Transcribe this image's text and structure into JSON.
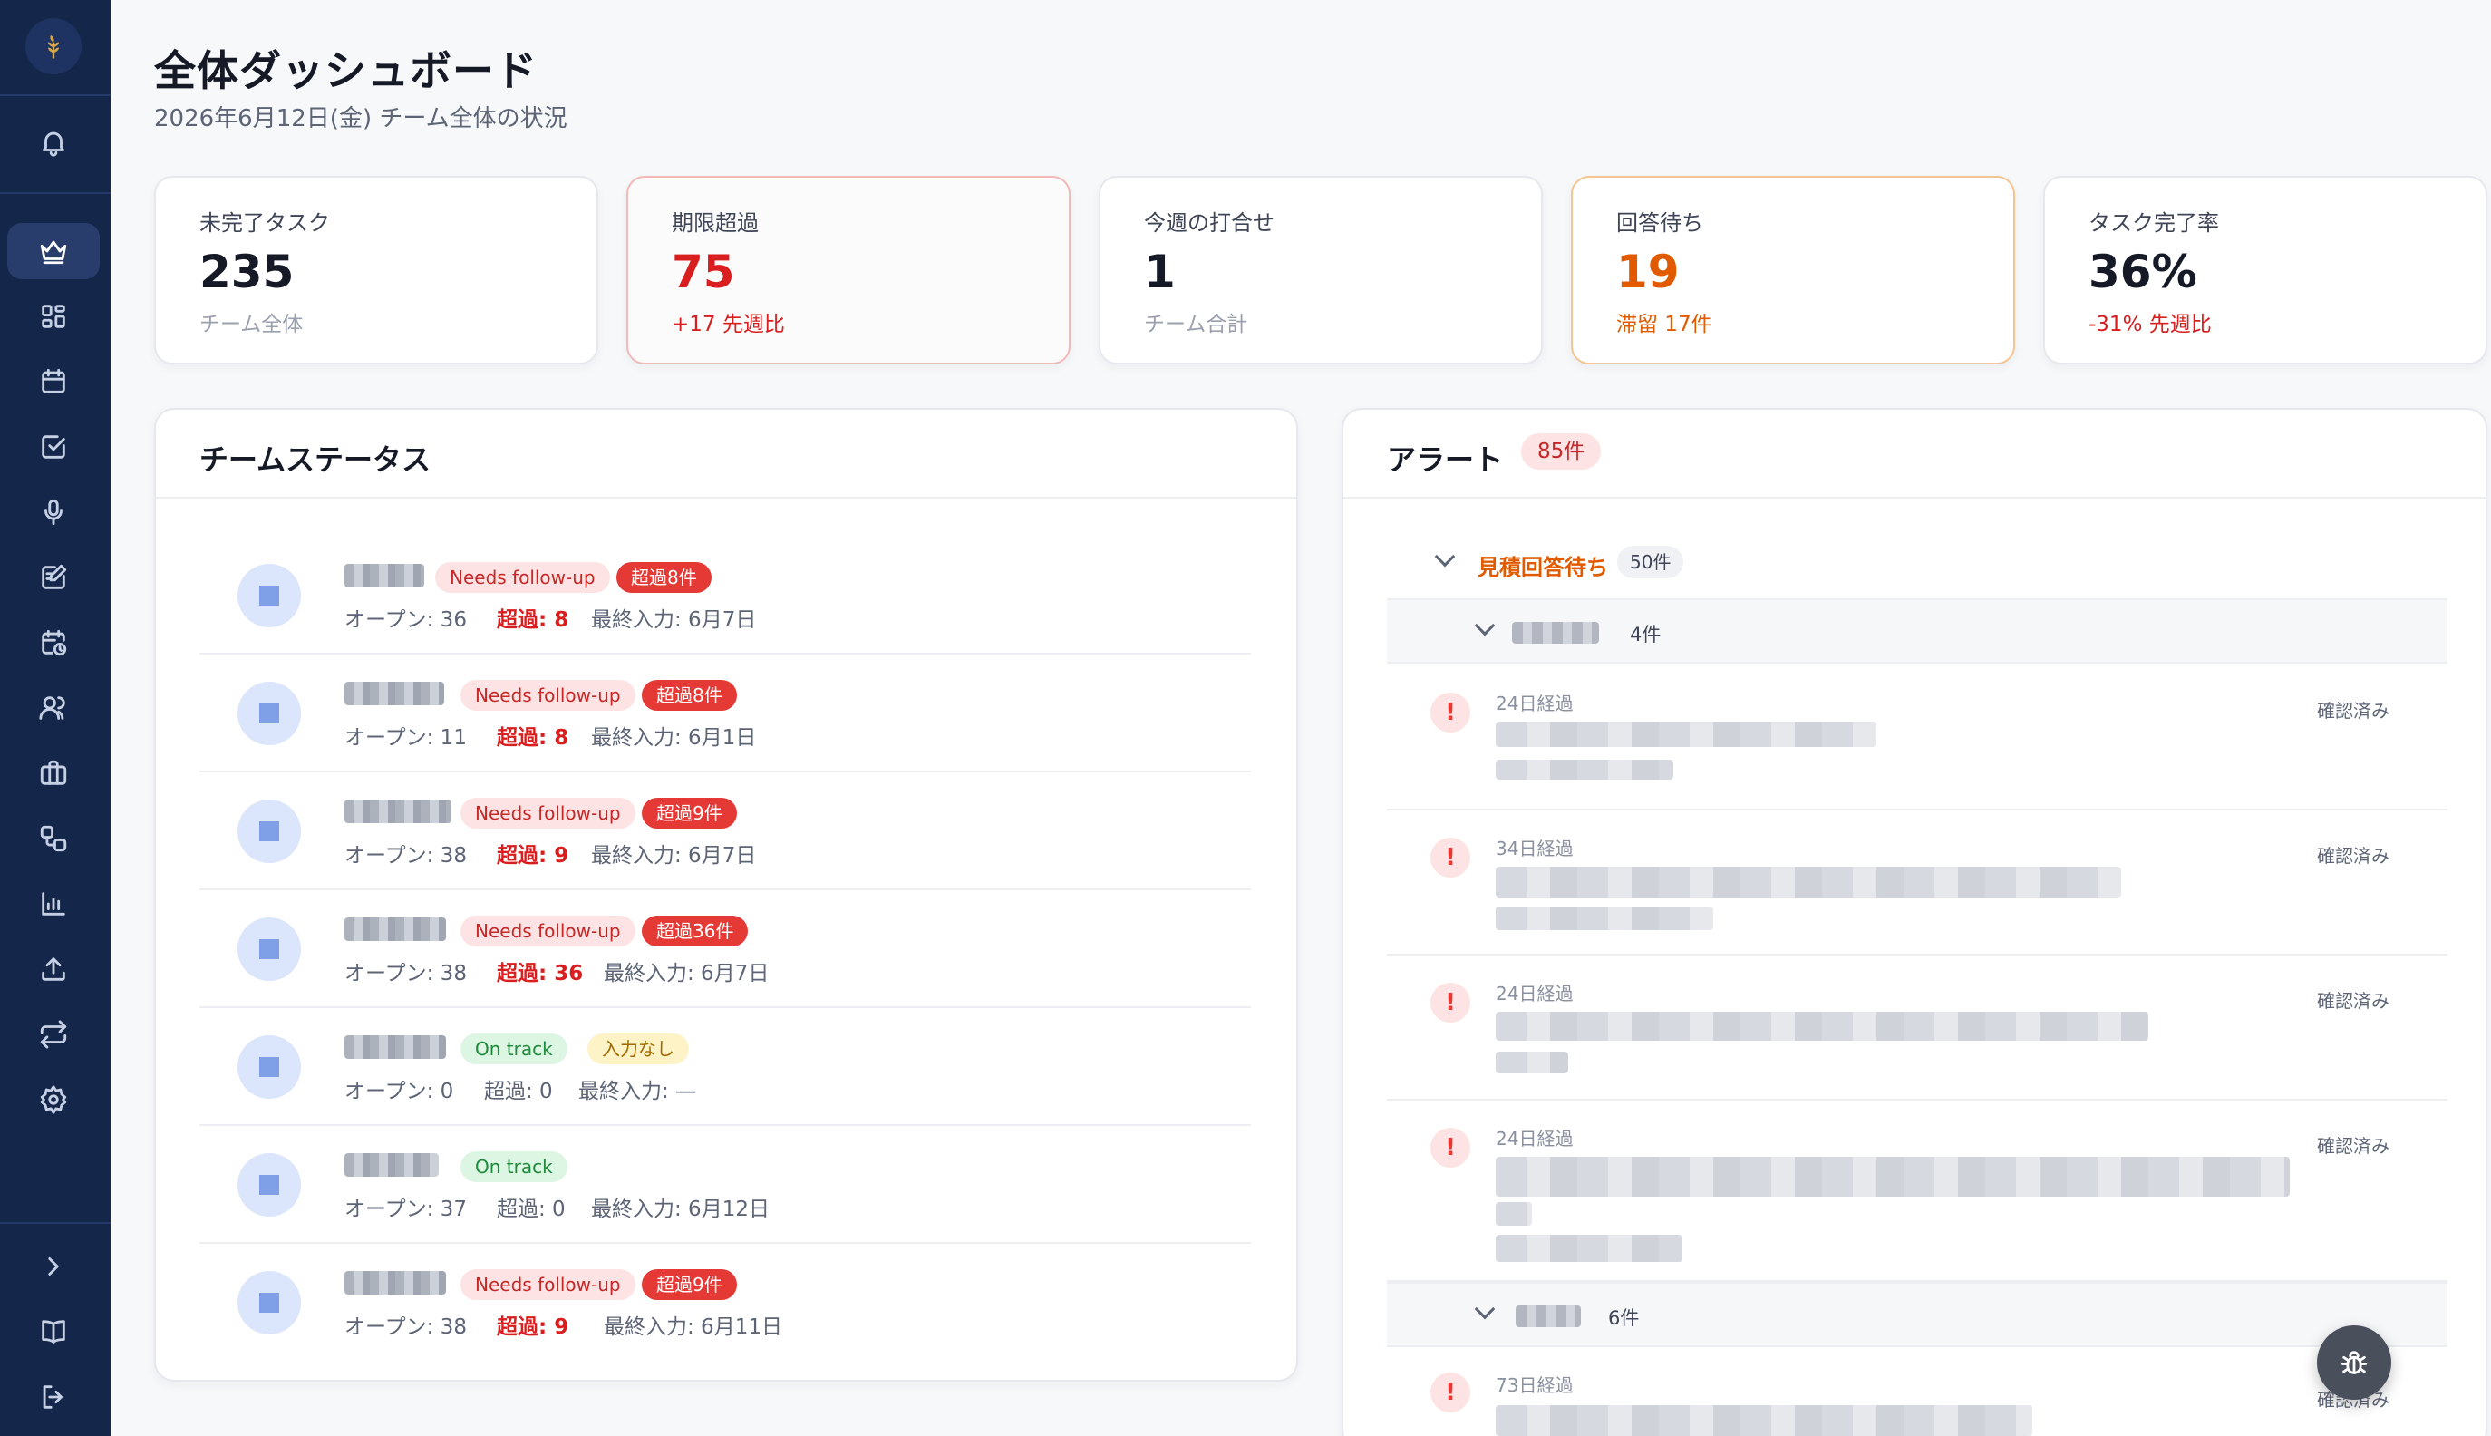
{
  "header": {
    "title": "全体ダッシュボード",
    "subtitle": "2026年6月12日(金) チーム全体の状況"
  },
  "stats": [
    {
      "label": "未完了タスク",
      "value": "235",
      "sub": "チーム全体"
    },
    {
      "label": "期限超過",
      "value": "75",
      "sub": "+17 先週比"
    },
    {
      "label": "今週の打合せ",
      "value": "1",
      "sub": "チーム合計"
    },
    {
      "label": "回答待ち",
      "value": "19",
      "sub": "滞留 17件"
    },
    {
      "label": "タスク完了率",
      "value": "36%",
      "sub": "-31% 先週比"
    }
  ],
  "team_status": {
    "title": "チームステータス",
    "members": [
      {
        "status": "Needs follow-up",
        "overdue_badge": "超過8件",
        "open": "オープン: 36",
        "overdue": "超過: 8",
        "last_input": "最終入力: 6月7日"
      },
      {
        "status": "Needs follow-up",
        "overdue_badge": "超過8件",
        "open": "オープン: 11",
        "overdue": "超過: 8",
        "last_input": "最終入力: 6月1日"
      },
      {
        "status": "Needs follow-up",
        "overdue_badge": "超過9件",
        "open": "オープン: 38",
        "overdue": "超過: 9",
        "last_input": "最終入力: 6月7日"
      },
      {
        "status": "Needs follow-up",
        "overdue_badge": "超過36件",
        "open": "オープン: 38",
        "overdue": "超過: 36",
        "last_input": "最終入力: 6月7日"
      },
      {
        "status": "On track",
        "overdue_badge": "入力なし",
        "open": "オープン: 0",
        "overdue": "超過: 0",
        "last_input": "最終入力: —"
      },
      {
        "status": "On track",
        "overdue_badge": "",
        "open": "オープン: 37",
        "overdue": "超過: 0",
        "last_input": "最終入力: 6月12日"
      },
      {
        "status": "Needs follow-up",
        "overdue_badge": "超過9件",
        "open": "オープン: 38",
        "overdue": "超過: 9",
        "last_input": "最終入力: 6月11日"
      }
    ]
  },
  "alerts": {
    "title": "アラート",
    "count": "85件",
    "group": {
      "title": "見積回答待ち",
      "count": "50件"
    },
    "subgroups": [
      {
        "count": "4件"
      },
      {
        "count": "6件"
      }
    ],
    "items": [
      {
        "elapsed": "24日経過",
        "action": "確認済み"
      },
      {
        "elapsed": "34日経過",
        "action": "確認済み"
      },
      {
        "elapsed": "24日経過",
        "action": "確認済み"
      },
      {
        "elapsed": "24日経過",
        "action": "確認済み"
      },
      {
        "elapsed": "73日経過",
        "action": "確認済み"
      }
    ],
    "warn_glyph": "!"
  },
  "icons": {
    "sidebar": [
      "bell-icon",
      "crown-icon",
      "grid-icon",
      "calendar-icon",
      "checkbox-icon",
      "mic-icon",
      "note-edit-icon",
      "calendar-clock-icon",
      "users-icon",
      "briefcase-icon",
      "workflow-icon",
      "bar-chart-icon",
      "upload-icon",
      "repeat-icon",
      "settings-icon",
      "chevron-right-icon",
      "book-icon",
      "logout-icon"
    ],
    "fab": "bug-icon"
  },
  "colors": {
    "sidebar": "#14264a",
    "danger": "#d81e1e",
    "warning": "#e15a00",
    "success": "#1e8a3b"
  }
}
